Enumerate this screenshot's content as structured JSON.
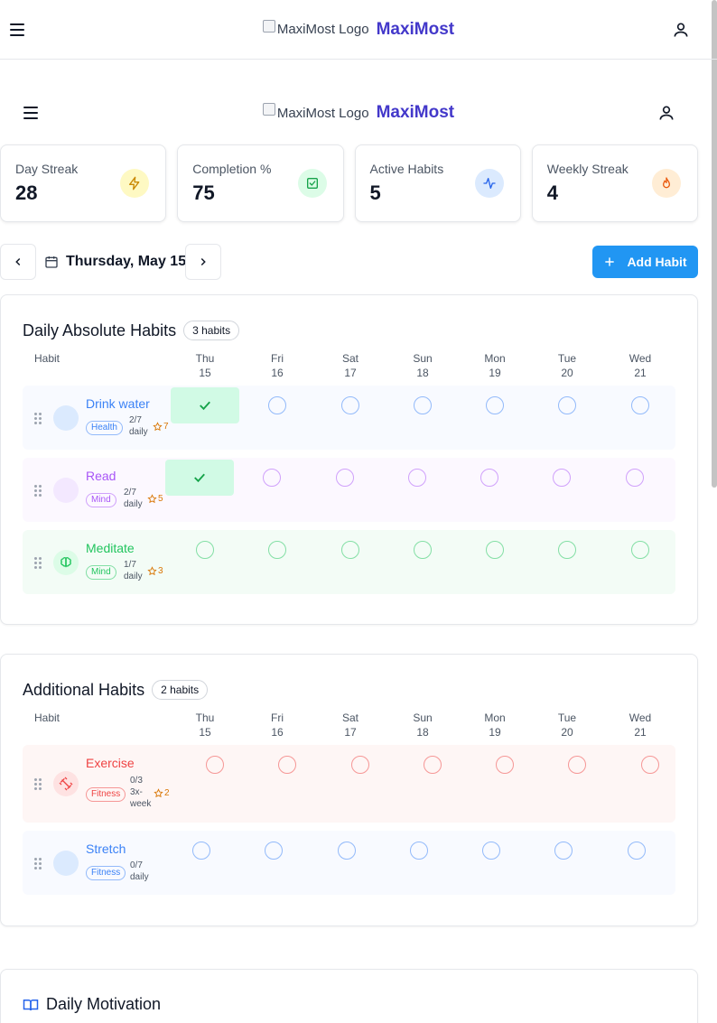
{
  "app": {
    "logo_alt": "MaxiMost Logo",
    "brand": "MaxiMost"
  },
  "stats": [
    {
      "label": "Day Streak",
      "value": "28",
      "icon": "zap-icon",
      "bg": "#fef9c3",
      "fg": "#ca8a04"
    },
    {
      "label": "Completion %",
      "value": "75",
      "icon": "check-square-icon",
      "bg": "#dcfce7",
      "fg": "#16a34a"
    },
    {
      "label": "Active Habits",
      "value": "5",
      "icon": "activity-icon",
      "bg": "#dbeafe",
      "fg": "#2563eb"
    },
    {
      "label": "Weekly Streak",
      "value": "4",
      "icon": "flame-icon",
      "bg": "#ffedd5",
      "fg": "#ea580c"
    }
  ],
  "date_bar": {
    "current_date": "Thursday, May 15",
    "add_label": "Add Habit"
  },
  "days": [
    {
      "day": "Thu",
      "date": "15"
    },
    {
      "day": "Fri",
      "date": "16"
    },
    {
      "day": "Sat",
      "date": "17"
    },
    {
      "day": "Sun",
      "date": "18"
    },
    {
      "day": "Mon",
      "date": "19"
    },
    {
      "day": "Tue",
      "date": "20"
    },
    {
      "day": "Wed",
      "date": "21"
    }
  ],
  "sections": [
    {
      "title": "Daily Absolute Habits",
      "count": "3 habits",
      "habit_col": "Habit",
      "habits": [
        {
          "name": "Drink water",
          "tag": "Health",
          "progress": [
            "2/7",
            "daily"
          ],
          "points": "7",
          "color": "#3b82f6",
          "bg": "#f8faff",
          "avatar_bg": "#dbeafe",
          "icon": "",
          "done": [
            true,
            false,
            false,
            false,
            false,
            false,
            false
          ]
        },
        {
          "name": "Read",
          "tag": "Mind",
          "progress": [
            "2/7",
            "daily"
          ],
          "points": "5",
          "color": "#a855f7",
          "bg": "#fcf8ff",
          "avatar_bg": "#f3e8ff",
          "icon": "",
          "done": [
            true,
            false,
            false,
            false,
            false,
            false,
            false
          ]
        },
        {
          "name": "Meditate",
          "tag": "Mind",
          "progress": [
            "1/7",
            "daily"
          ],
          "points": "3",
          "color": "#22c55e",
          "bg": "#f3fcf6",
          "avatar_bg": "#dcfce7",
          "icon": "brain-icon",
          "done": [
            false,
            false,
            false,
            false,
            false,
            false,
            false
          ]
        }
      ]
    },
    {
      "title": "Additional Habits",
      "count": "2 habits",
      "habit_col": "Habit",
      "habits": [
        {
          "name": "Exercise",
          "tag": "Fitness",
          "progress": [
            "0/3",
            "3x-",
            "week"
          ],
          "points": "2",
          "color": "#ef4444",
          "bg": "#fef6f5",
          "avatar_bg": "#fee2e2",
          "icon": "dumbbell-icon",
          "done": [
            false,
            false,
            false,
            false,
            false,
            false,
            false
          ]
        },
        {
          "name": "Stretch",
          "tag": "Fitness",
          "progress": [
            "0/7",
            "daily"
          ],
          "points": "",
          "color": "#3b82f6",
          "bg": "#f8faff",
          "avatar_bg": "#dbeafe",
          "icon": "",
          "done": [
            false,
            false,
            false,
            false,
            false,
            false,
            false
          ]
        }
      ]
    }
  ],
  "motivation": {
    "title": "Daily Motivation"
  }
}
